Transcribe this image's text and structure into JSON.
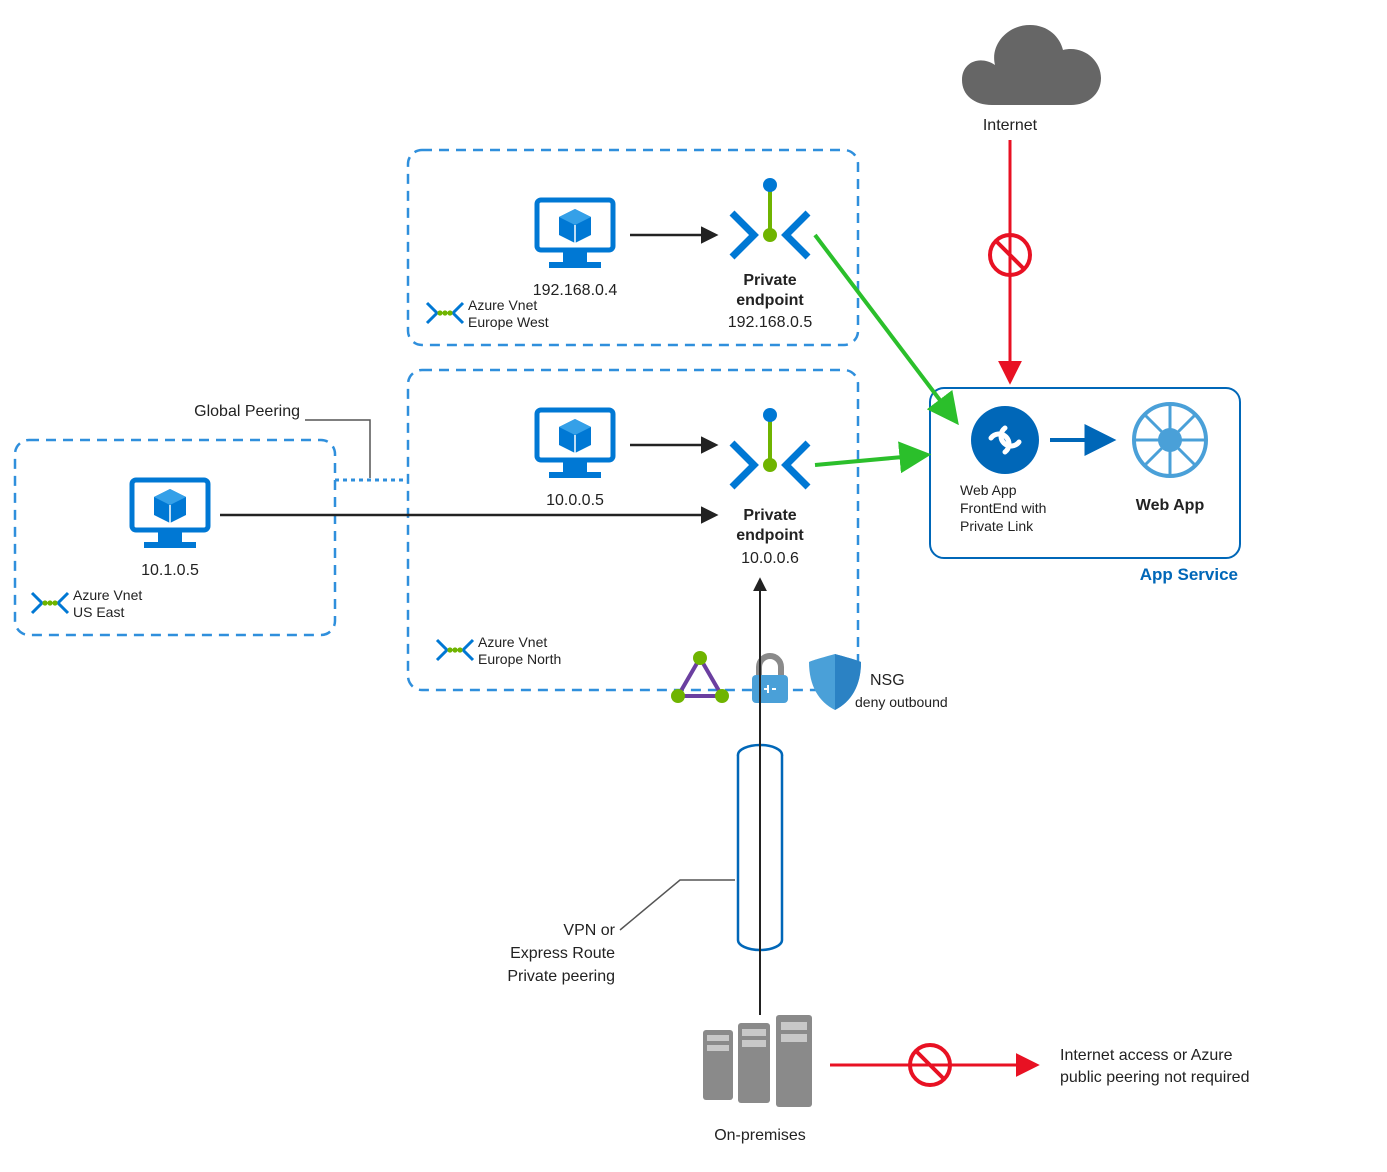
{
  "internet": {
    "label": "Internet"
  },
  "vnet_eu_west": {
    "name_line1": "Azure Vnet",
    "name_line2": "Europe West",
    "vm_ip": "192.168.0.4",
    "pe_title": "Private",
    "pe_title2": "endpoint",
    "pe_ip": "192.168.0.5"
  },
  "vnet_eu_north": {
    "name_line1": "Azure Vnet",
    "name_line2": "Europe North",
    "vm_ip": "10.0.0.5",
    "pe_title": "Private",
    "pe_title2": "endpoint",
    "pe_ip": "10.0.0.6"
  },
  "vnet_us_east": {
    "name_line1": "Azure Vnet",
    "name_line2": "US East",
    "vm_ip": "10.1.0.5"
  },
  "global_peering_label": "Global Peering",
  "nsg_label": "NSG",
  "nsg_sub": "deny outbound",
  "vpn_line1": "VPN or",
  "vpn_line2": "Express Route",
  "vpn_line3": "Private peering",
  "onprem_label": "On-premises",
  "onprem_note_line1": "Internet access or Azure",
  "onprem_note_line2": "public peering not required",
  "app_service": {
    "box_label": "App Service",
    "frontend_line1": "Web App",
    "frontend_line2": "FrontEnd with",
    "frontend_line3": "Private Link",
    "webapp_label": "Web App"
  },
  "colors": {
    "azure_blue": "#0078d4",
    "azure_dash": "#2f8fdc",
    "green": "#5fbf00",
    "green_arrow": "#2bbf2b",
    "red": "#e81123",
    "gray": "#666666",
    "onprem_gray": "#7a7a7a",
    "peer_green": "#6fb400"
  }
}
